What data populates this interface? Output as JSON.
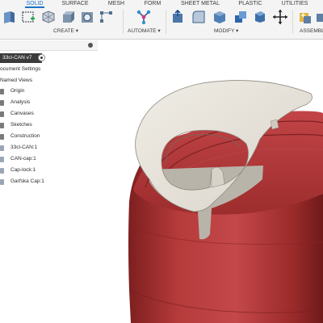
{
  "toolbar": {
    "tabs": [
      {
        "label": "SOLID",
        "active": true
      },
      {
        "label": "SURFACE",
        "active": false
      },
      {
        "label": "MESH",
        "active": false
      },
      {
        "label": "FORM",
        "active": false
      },
      {
        "label": "SHEET METAL",
        "active": false
      },
      {
        "label": "PLASTIC",
        "active": false
      },
      {
        "label": "UTILITIES",
        "active": false
      }
    ],
    "groups": {
      "create": "CREATE ▾",
      "automate": "AUTOMATE ▾",
      "modify": "MODIFY ▾",
      "assemble": "ASSEMBL"
    },
    "accent_color": "#1a73c9"
  },
  "browser": {
    "root": "33cl-CAN v7",
    "items": [
      {
        "label": "ocument Settings",
        "icon": "settings-icon"
      },
      {
        "label": "Named Views",
        "icon": "folder-icon"
      },
      {
        "label": "Origin",
        "icon": "folder-icon"
      },
      {
        "label": "Analysis",
        "icon": "folder-icon"
      },
      {
        "label": "Canvases",
        "icon": "folder-icon"
      },
      {
        "label": "Sketches",
        "icon": "folder-icon"
      },
      {
        "label": "Construction",
        "icon": "folder-icon"
      },
      {
        "label": "33cl-CAN:1",
        "icon": "component-icon"
      },
      {
        "label": "CAN-cap:1",
        "icon": "component-icon"
      },
      {
        "label": "Cap-lock:1",
        "icon": "component-icon"
      },
      {
        "label": "Garfska Cap:1",
        "icon": "component-icon"
      }
    ]
  },
  "viewport": {
    "can_color": "#b53a3a",
    "cap_color": "#e6e2da"
  }
}
